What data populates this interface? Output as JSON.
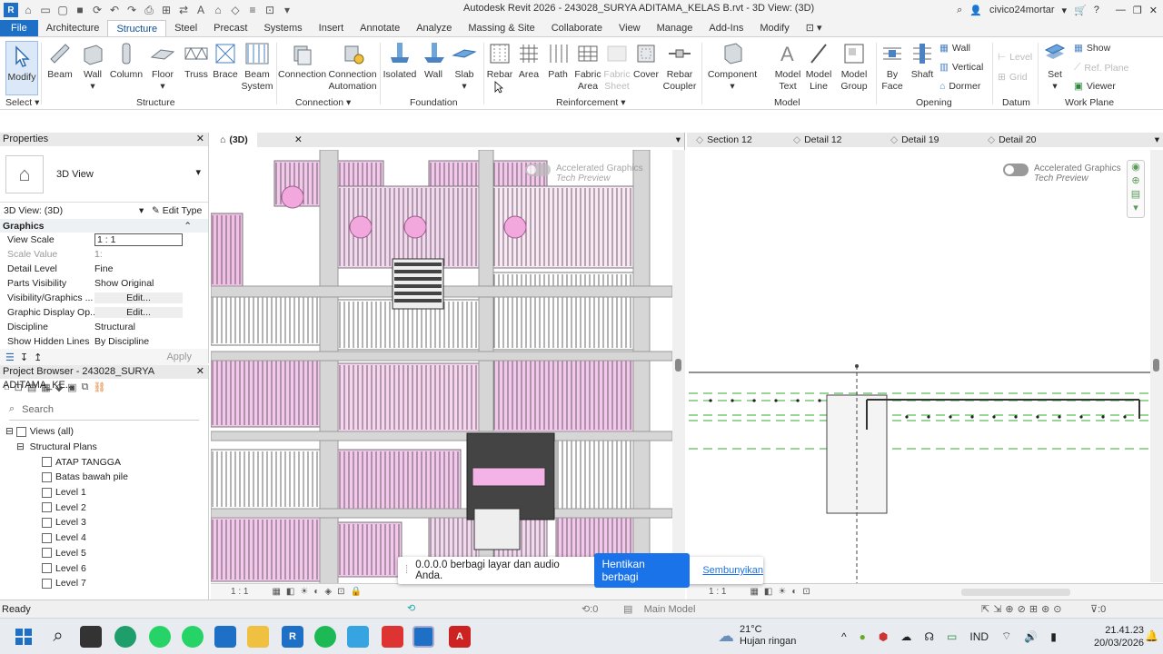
{
  "title_bar": {
    "doc_title": "Autodesk Revit 2026 - 243028_SURYA ADITAMA_KELAS B.rvt - 3D View: (3D)",
    "user": "civico24mortar"
  },
  "tabs": [
    "File",
    "Architecture",
    "Structure",
    "Steel",
    "Precast",
    "Systems",
    "Insert",
    "Annotate",
    "Analyze",
    "Massing & Site",
    "Collaborate",
    "View",
    "Manage",
    "Add-Ins",
    "Modify"
  ],
  "active_tab": "Structure",
  "ribbon": {
    "modify": "Modify",
    "beam": "Beam",
    "wall": "Wall",
    "column": "Column",
    "floor": "Floor",
    "truss": "Truss",
    "brace": "Brace",
    "beam_system": "Beam\nSystem",
    "connection": "Connection",
    "connection_automation": "Connection\nAutomation",
    "isolated": "Isolated",
    "f_wall": "Wall",
    "slab": "Slab",
    "rebar": "Rebar",
    "area": "Area",
    "path": "Path",
    "fabric_area": "Fabric\nArea",
    "fabric_sheet": "Fabric\nSheet",
    "cover": "Cover",
    "rebar_coupler": "Rebar\nCoupler",
    "component": "Component",
    "model_text": "Model\nText",
    "model_line": "Model\nLine",
    "model_group": "Model\nGroup",
    "by_face": "By\nFace",
    "shaft": "Shaft",
    "o_wall": "Wall",
    "vertical": "Vertical",
    "dormer": "Dormer",
    "level": "Level",
    "grid": "Grid",
    "set": "Set",
    "show": "Show",
    "ref_plane": "Ref. Plane",
    "viewer": "Viewer",
    "panels": {
      "select": "Select",
      "structure": "Structure",
      "connection": "Connection",
      "foundation": "Foundation",
      "reinforcement": "Reinforcement",
      "model": "Model",
      "opening": "Opening",
      "datum": "Datum",
      "work_plane": "Work Plane"
    }
  },
  "properties": {
    "title": "Properties",
    "type": "3D View",
    "instance": "3D View: (3D)",
    "edit_type": "Edit Type",
    "section": "Graphics",
    "rows": [
      [
        "View Scale",
        "1 : 1"
      ],
      [
        "Scale Value",
        "1:",
        "1"
      ],
      [
        "Detail Level",
        "Fine"
      ],
      [
        "Parts Visibility",
        "Show Original"
      ],
      [
        "Visibility/Graphics ...",
        "Edit..."
      ],
      [
        "Graphic Display Op...",
        "Edit..."
      ],
      [
        "Discipline",
        "Structural"
      ],
      [
        "Show Hidden Lines",
        "By Discipline"
      ]
    ],
    "apply": "Apply"
  },
  "browser": {
    "title": "Project Browser - 243028_SURYA ADITAMA_KE...",
    "search": "Search",
    "views_all": "Views (all)",
    "structural_plans": "Structural Plans",
    "items": [
      "ATAP TANGGA",
      "Batas bawah pile",
      "Level 1",
      "Level 2",
      "Level 3",
      "Level 4",
      "Level 5",
      "Level 6",
      "Level 7"
    ]
  },
  "view3d": {
    "tab": "(3D)",
    "accel": "Accelerated Graphics",
    "accel2": "Tech Preview",
    "scale": "1 : 1"
  },
  "viewR": {
    "tabs": [
      "Section 12",
      "Detail 12",
      "Detail 19",
      "Detail 20"
    ],
    "accel": "Accelerated Graphics",
    "accel2": "Tech Preview",
    "scale": "1 : 1"
  },
  "share": {
    "message": "0.0.0.0 berbagi layar dan audio Anda.",
    "stop": "Hentikan berbagi",
    "hide": "Sembunyikan"
  },
  "status": {
    "ready": "Ready",
    "zero": ":0",
    "main_model": "Main Model",
    "filter": ":0"
  },
  "taskbar": {
    "temp": "21°C",
    "weather": "Hujan ringan",
    "lang": "IND",
    "time": "21.41.23",
    "date": "20/03/2026"
  }
}
